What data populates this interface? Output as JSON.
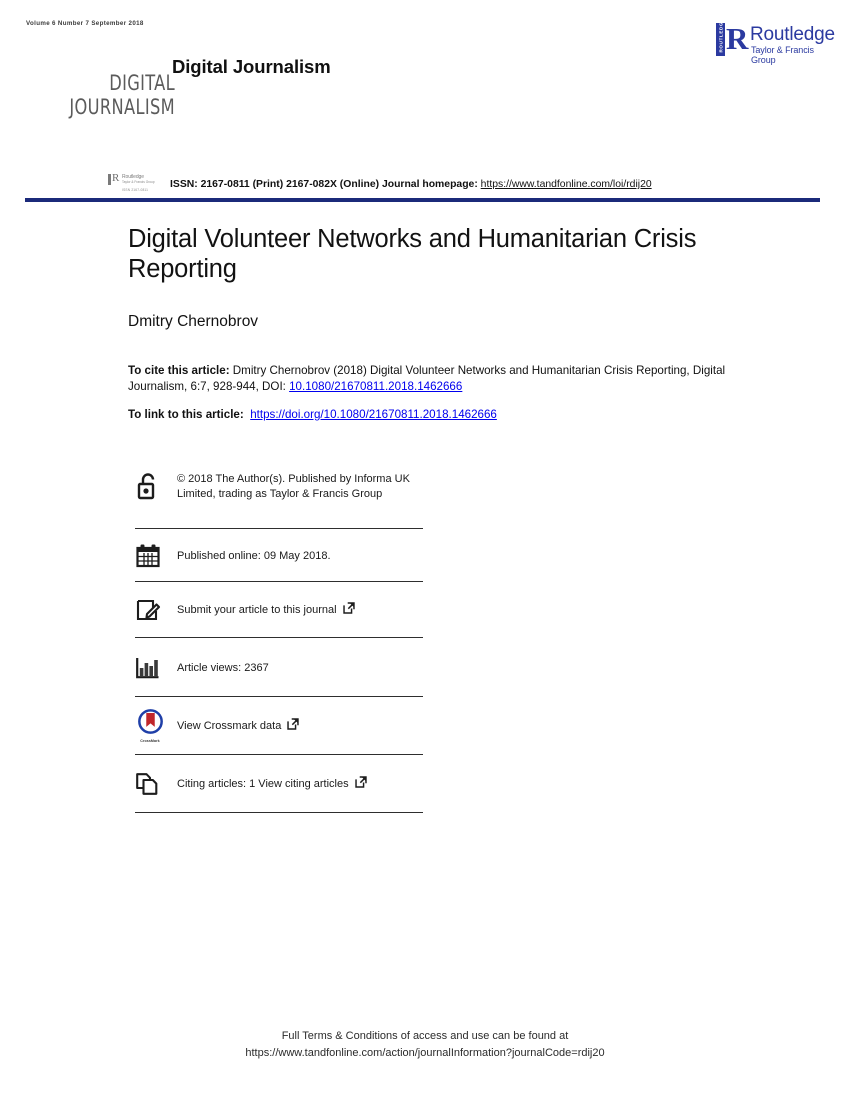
{
  "header": {
    "volume_line": "Volume 6   Number 7   September 2018",
    "masthead_line1": "DIGITAL",
    "masthead_line2": "JOURNALISM",
    "journal_title": "Digital Journalism",
    "publisher_logo": {
      "vertical_text": "ROUTLEDGE",
      "glyph": "R",
      "name": "Routledge",
      "subtitle": "Taylor & Francis Group",
      "color": "#2b3aa0"
    }
  },
  "issn_bar": {
    "mini_logo": {
      "glyph": "R",
      "name": "Routledge",
      "subtitle": "Taylor & Francis Group",
      "code": "ISSN  2167-0811"
    },
    "label": "ISSN: 2167-0811 (Print) 2167-082X (Online) Journal homepage: ",
    "homepage_url": "https://www.tandfonline.com/loi/rdij20",
    "rule_color": "#1b2a7a"
  },
  "article": {
    "title": "Digital Volunteer Networks and Humanitarian Crisis Reporting",
    "author": "Dmitry Chernobrov",
    "cite_label": "To cite this article:",
    "cite_text": " Dmitry Chernobrov (2018) Digital Volunteer Networks and Humanitarian Crisis Reporting, Digital Journalism, 6:7, 928-944, DOI: ",
    "cite_doi": "10.1080/21670811.2018.1462666",
    "link_label": "To link to this article:",
    "link_url": "https://doi.org/10.1080/21670811.2018.1462666"
  },
  "metadata_rows": [
    {
      "icon": "open-access-icon",
      "text": "© 2018 The Author(s). Published by Informa UK Limited, trading as Taylor & Francis Group",
      "external_link": false
    },
    {
      "icon": "calendar-icon",
      "text": "Published online: 09 May 2018.",
      "external_link": false
    },
    {
      "icon": "submit-article-icon",
      "text": "Submit your article to this journal",
      "external_link": true
    },
    {
      "icon": "article-views-icon",
      "text": "Article views: 2367",
      "external_link": false
    },
    {
      "icon": "crossmark-icon",
      "icon_caption": "CrossMark",
      "text": "View Crossmark data",
      "external_link": true
    },
    {
      "icon": "citing-articles-icon",
      "text": "Citing articles: 1 View citing articles",
      "external_link": true
    }
  ],
  "footer": {
    "line1": "Full Terms & Conditions of access and use can be found at",
    "line2": "https://www.tandfonline.com/action/journalInformation?journalCode=rdij20"
  }
}
